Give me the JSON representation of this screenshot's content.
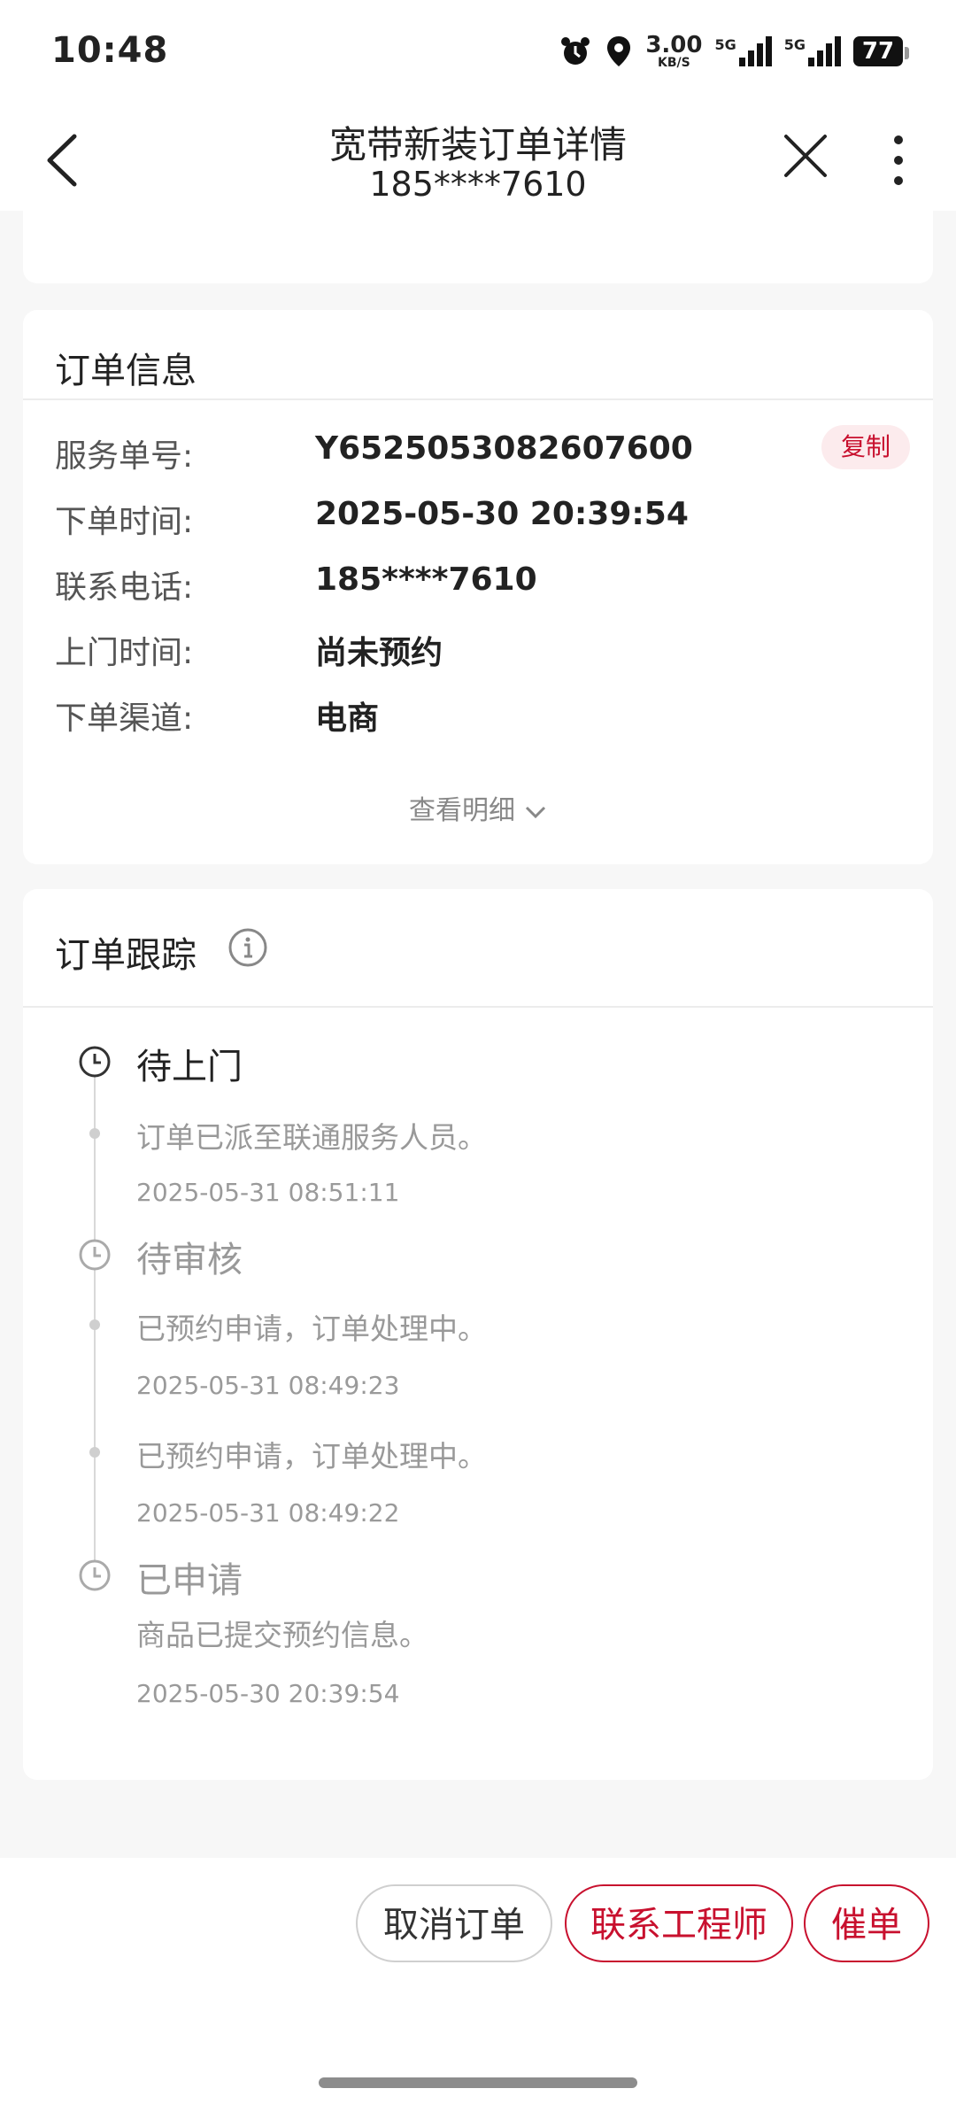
{
  "status_bar": {
    "time": "10:48",
    "net_speed": "3.00",
    "net_speed_unit": "KB/S",
    "net1": "5G",
    "net2": "5G",
    "battery": "77",
    "icons": [
      "alarm-icon",
      "location-icon",
      "signal-icon",
      "battery-icon"
    ]
  },
  "nav": {
    "title": "宽带新装订单详情",
    "subtitle": "185****7610"
  },
  "order_info": {
    "title": "订单信息",
    "rows": [
      {
        "label": "服务单号:",
        "value": "Y6525053082607600"
      },
      {
        "label": "下单时间:",
        "value": "2025-05-30 20:39:54"
      },
      {
        "label": "联系电话:",
        "value": "185****7610"
      },
      {
        "label": "上门时间:",
        "value": "尚未预约"
      },
      {
        "label": "下单渠道:",
        "value": "电商"
      }
    ],
    "copy_label": "复制",
    "detail_label": "查看明细"
  },
  "tracking": {
    "title": "订单跟踪",
    "statuses": [
      {
        "status": "待上门",
        "desc": "订单已派至联通服务人员。",
        "time": "2025-05-31 08:51:11"
      },
      {
        "status": "待审核",
        "desc": "已预约申请，订单处理中。",
        "time": "2025-05-31 08:49:23"
      },
      {
        "status": "",
        "desc": "已预约申请，订单处理中。",
        "time": "2025-05-31 08:49:22"
      },
      {
        "status": "已申请",
        "desc": "商品已提交预约信息。",
        "time": "2025-05-30 20:39:54"
      }
    ]
  },
  "actions": {
    "cancel": "取消订单",
    "contact": "联系工程师",
    "urge": "催单"
  },
  "colors": {
    "accent": "#c8102e",
    "copy_bg": "#fcebed"
  }
}
